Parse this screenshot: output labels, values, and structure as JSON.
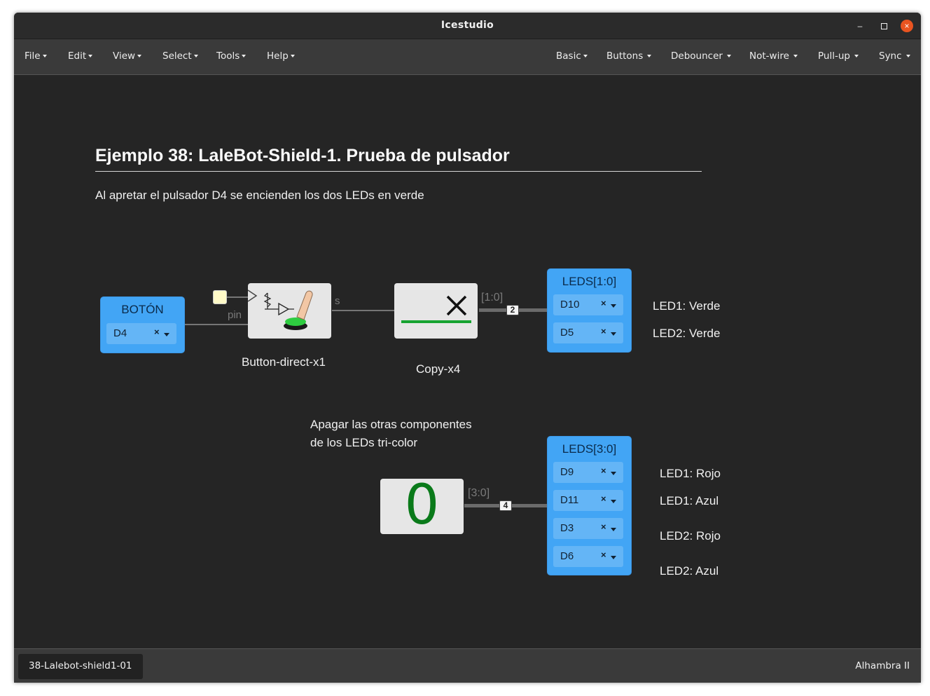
{
  "window": {
    "title": "Icestudio"
  },
  "menu": {
    "left": [
      "File",
      "Edit",
      "View",
      "Select",
      "Tools",
      "Help"
    ],
    "right": [
      "Basic",
      "Buttons",
      "Debouncer",
      "Not-wire",
      "Pull-up",
      "Sync"
    ]
  },
  "canvas": {
    "heading": "Ejemplo 38: LaleBot-Shield-1. Prueba de pulsador",
    "description": "Al apretar el pulsador D4 se encienden los dos LEDs en verde",
    "note_line1": "Apagar las otras componentes",
    "note_line2": "de los LEDs tri-color"
  },
  "blocks": {
    "boton": {
      "title": "BOTÓN",
      "pin": "D4"
    },
    "button_direct": {
      "label": "Button-direct-x1",
      "in_pin": "pin",
      "out_pin": "s"
    },
    "copy": {
      "label": "Copy-x4"
    },
    "leds1": {
      "title": "LEDS[1:0]",
      "pins": [
        "D10",
        "D5"
      ]
    },
    "leds2": {
      "title": "LEDS[3:0]",
      "pins": [
        "D9",
        "D11",
        "D3",
        "D6"
      ]
    },
    "constant": {
      "value": "0"
    }
  },
  "wires": {
    "bus1": {
      "label": "[1:0]",
      "size": "2"
    },
    "bus2": {
      "label": "[3:0]",
      "size": "4"
    }
  },
  "led_labels_1": [
    "LED1: Verde",
    "LED2: Verde"
  ],
  "led_labels_2": [
    "LED1: Rojo",
    "LED1: Azul",
    "LED2: Rojo",
    "LED2: Azul"
  ],
  "status": {
    "tab": "38-Lalebot-shield1-01",
    "board": "Alhambra II"
  },
  "icons": {
    "pin_clear": "×",
    "window_close": "×",
    "window_minimize": "–",
    "window_maximize": "□"
  },
  "colors": {
    "io_block": "#42a5f5",
    "io_pin_select": "#64b5f6",
    "constant_value": "#0a7a1a",
    "copy_bar": "#16a330",
    "window_close": "#e95420"
  }
}
